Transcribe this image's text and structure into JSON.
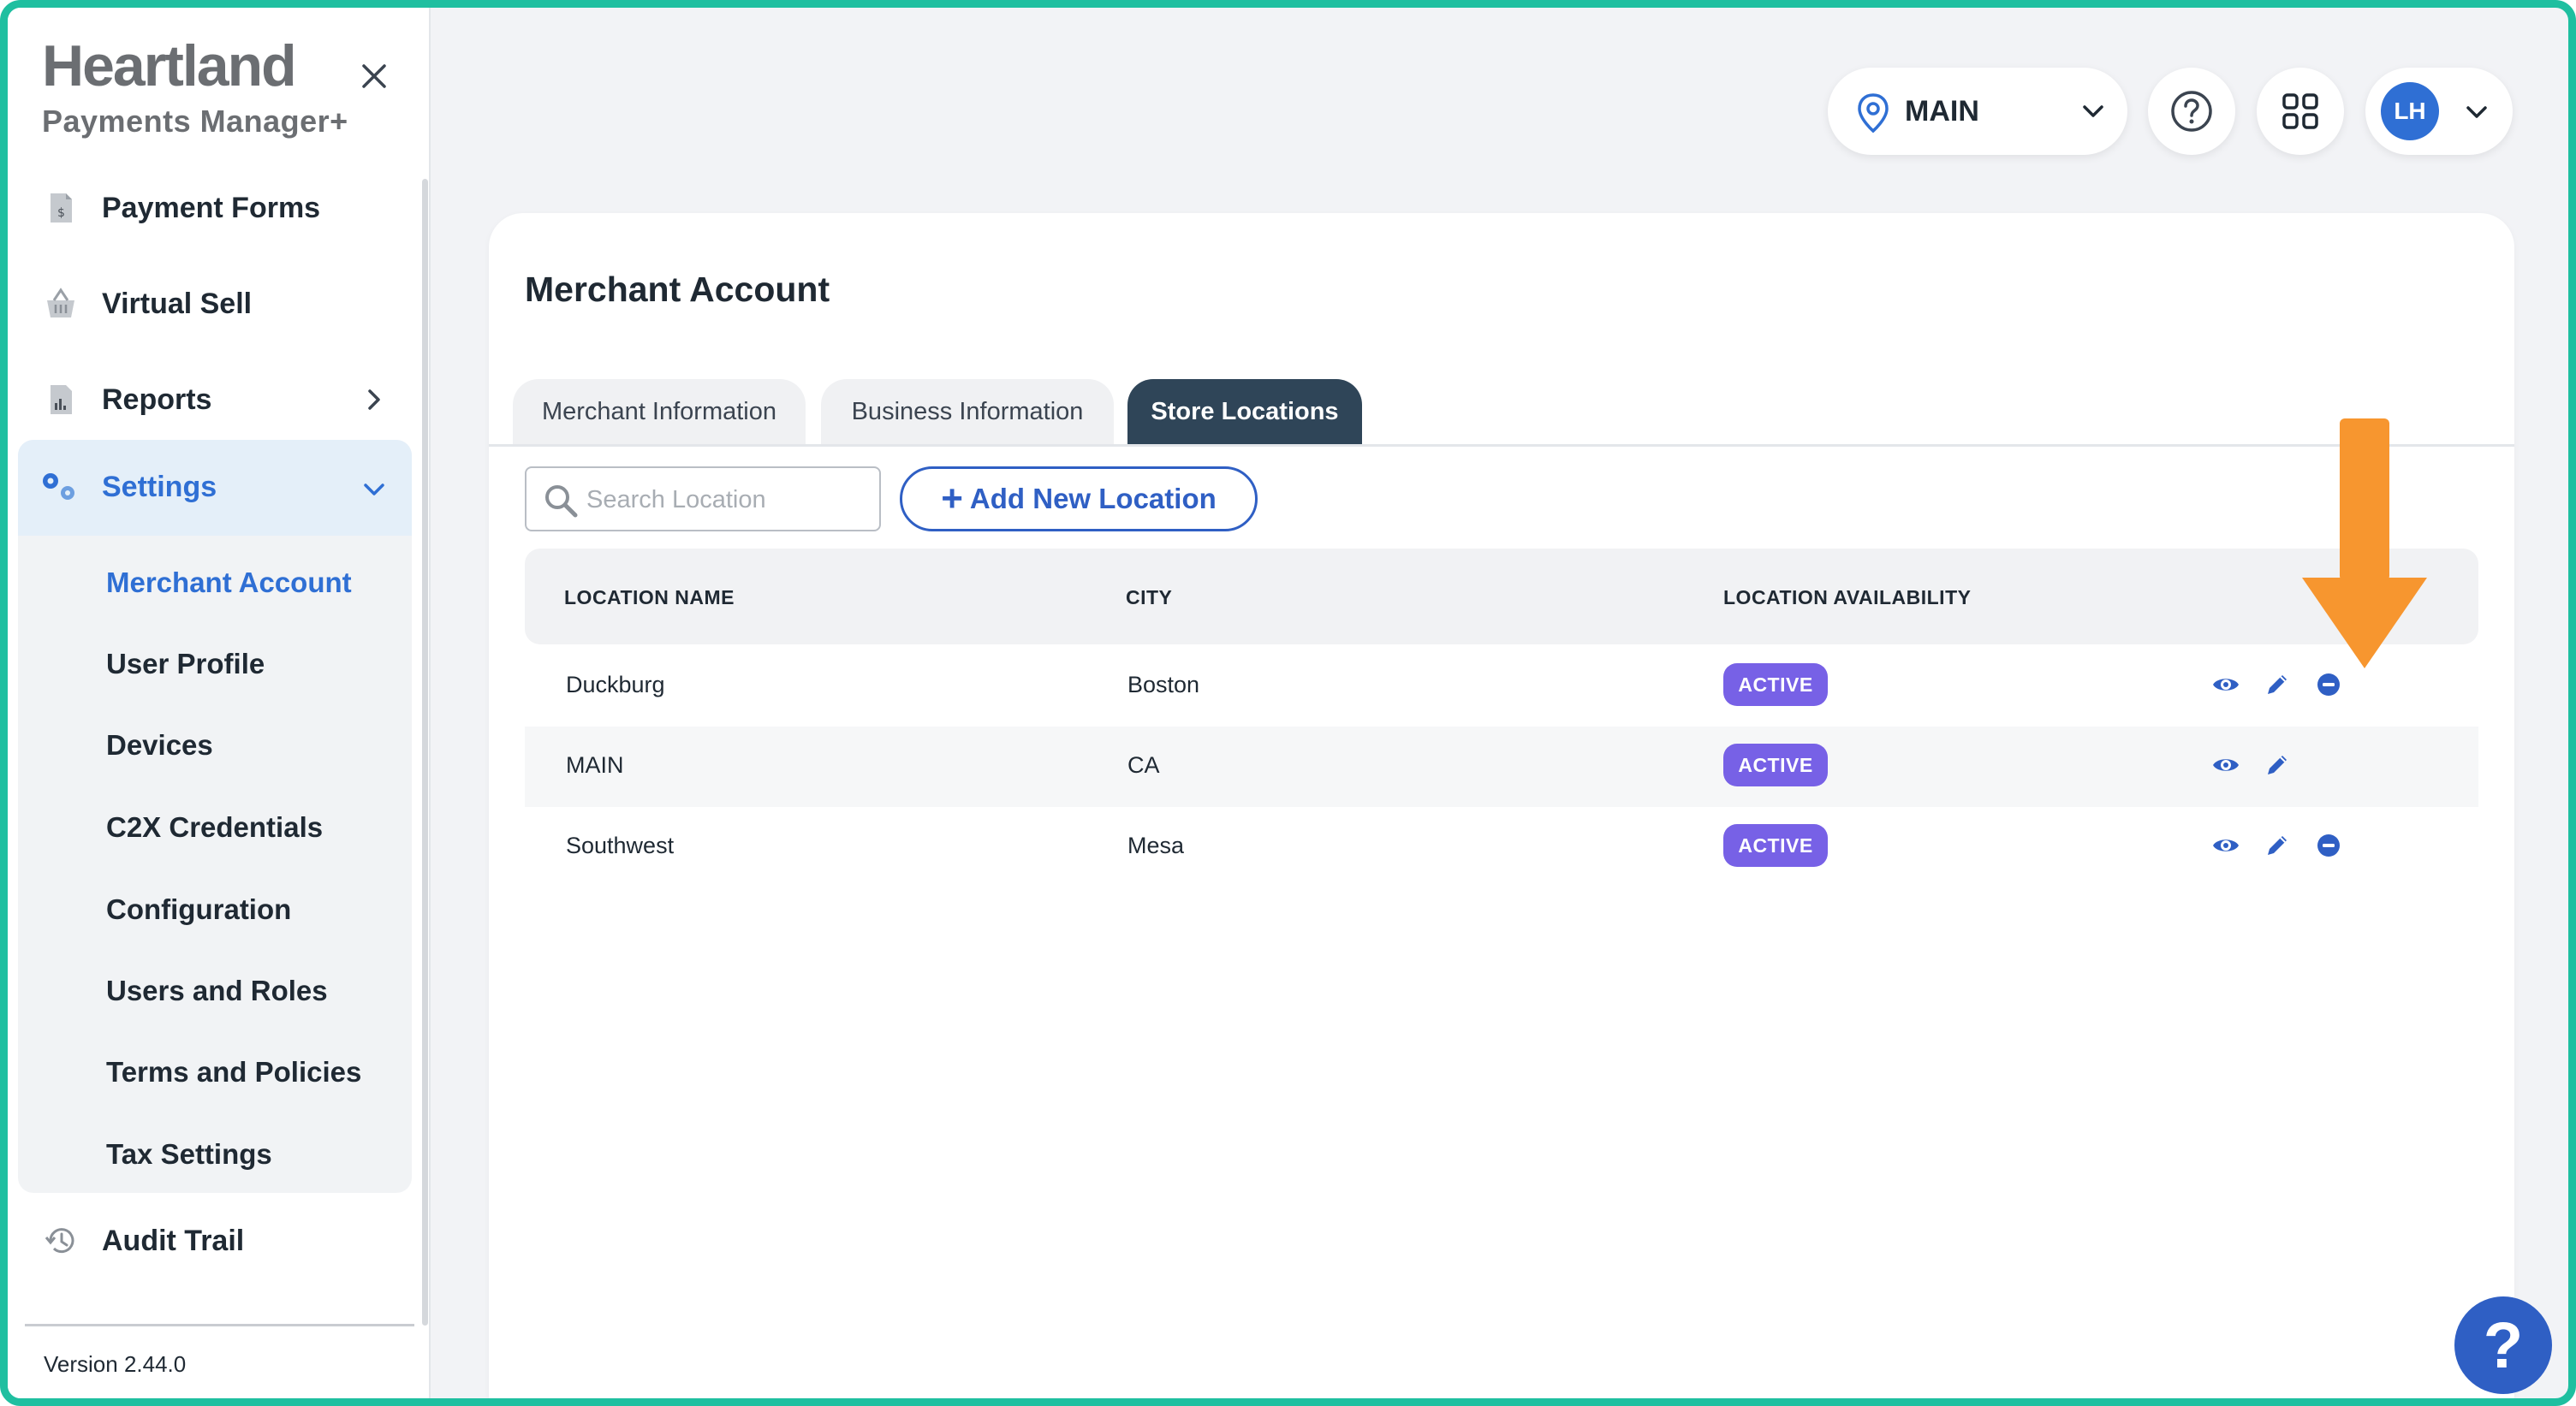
{
  "sidebar": {
    "brand_name": "Heartland",
    "brand_sub": "Payments Manager+",
    "items": [
      {
        "label": "Payment Forms"
      },
      {
        "label": "Virtual Sell"
      },
      {
        "label": "Reports"
      },
      {
        "label": "Settings"
      }
    ],
    "settings_sub": [
      {
        "label": "Merchant Account"
      },
      {
        "label": "User Profile"
      },
      {
        "label": "Devices"
      },
      {
        "label": "C2X Credentials"
      },
      {
        "label": "Configuration"
      },
      {
        "label": "Users and Roles"
      },
      {
        "label": "Terms and Policies"
      },
      {
        "label": "Tax Settings"
      }
    ],
    "audit_label": "Audit Trail",
    "version": "Version 2.44.0"
  },
  "topbar": {
    "location": "MAIN",
    "avatar_initials": "LH"
  },
  "page": {
    "title": "Merchant Account",
    "tabs": [
      {
        "label": "Merchant Information"
      },
      {
        "label": "Business Information"
      },
      {
        "label": "Store Locations"
      }
    ],
    "active_tab": "Store Locations",
    "search_placeholder": "Search Location",
    "add_button": "Add New Location",
    "add_plus": "+",
    "columns": {
      "name": "LOCATION NAME",
      "city": "CITY",
      "availability": "LOCATION AVAILABILITY"
    },
    "rows": [
      {
        "name": "Duckburg",
        "city": "Boston",
        "status": "ACTIVE",
        "removable": true
      },
      {
        "name": "MAIN",
        "city": "CA",
        "status": "ACTIVE",
        "removable": false
      },
      {
        "name": "Southwest",
        "city": "Mesa",
        "status": "ACTIVE",
        "removable": true
      }
    ]
  },
  "help_fab": "?",
  "colors": {
    "frame": "#1fbfa0",
    "accent": "#2f6fd4",
    "active_tab": "#2f4558",
    "badge": "#7761e6",
    "annotation_arrow": "#f7962f"
  }
}
